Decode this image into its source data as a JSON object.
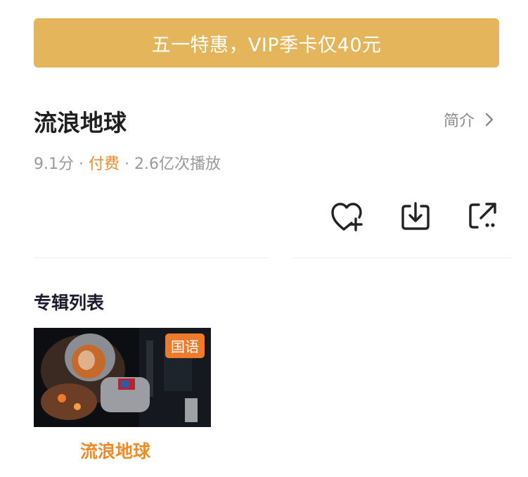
{
  "promo_banner": {
    "text": "五一特惠，VIP季卡仅40元"
  },
  "show": {
    "title": "流浪地球",
    "intro_label": "简介",
    "score": "9.1分",
    "separator": " · ",
    "pay_status": "付费",
    "plays": "2.6亿次播放"
  },
  "actions": [
    {
      "icon": "heart-plus-icon"
    },
    {
      "icon": "download-icon"
    },
    {
      "icon": "share-icon"
    }
  ],
  "album_section": {
    "title": "专辑列表",
    "items": [
      {
        "badge": "国语",
        "name": "流浪地球"
      }
    ]
  },
  "colors": {
    "banner": "#e4b55a",
    "accent": "#f08a24",
    "badge": "#ee7a2b"
  }
}
